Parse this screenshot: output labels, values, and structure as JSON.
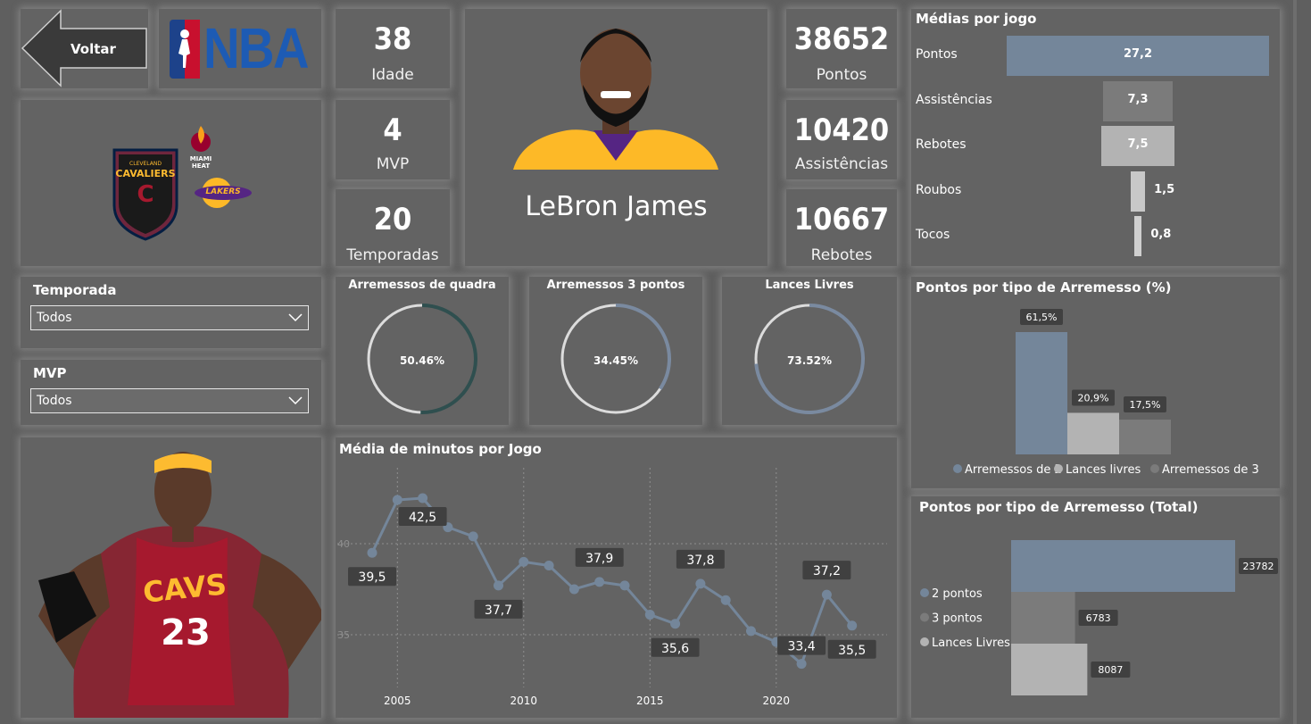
{
  "nav": {
    "back_label": "Voltar",
    "logo_text": "NBA"
  },
  "stats_left": [
    {
      "value": "38",
      "label": "Idade"
    },
    {
      "value": "4",
      "label": "MVP"
    },
    {
      "value": "20",
      "label": "Temporadas"
    }
  ],
  "stats_right": [
    {
      "value": "38652",
      "label": "Pontos"
    },
    {
      "value": "10420",
      "label": "Assistências"
    },
    {
      "value": "10667",
      "label": "Rebotes"
    }
  ],
  "player": {
    "name": "LeBron James",
    "jersey_number": "23",
    "jersey_text": "CAVS"
  },
  "teams": {
    "cavaliers_top": "CLEVELAND",
    "cavaliers_main": "CAVALIERS",
    "heat_top": "MIAMI",
    "heat_bottom": "HEAT",
    "lakers": "LAKERS"
  },
  "filters": [
    {
      "title": "Temporada",
      "value": "Todos"
    },
    {
      "title": "MVP",
      "value": "Todos"
    }
  ],
  "rings": [
    {
      "title": "Arremessos de quadra",
      "label": "50.46%",
      "value": 0.5046,
      "color": "#2f4f4f"
    },
    {
      "title": "Arremessos 3 pontos",
      "label": "34.45%",
      "value": 0.3445,
      "color": "#7a8aa0"
    },
    {
      "title": "Lances Livres",
      "label": "73.52%",
      "value": 0.7352,
      "color": "#7a8aa0"
    }
  ],
  "colors": {
    "steel": "#74869a",
    "gray_mid": "#7b7b7b",
    "gray_light": "#b3b3b3",
    "card": "#636363",
    "dark_label": "#404040"
  },
  "chart_data": [
    {
      "type": "bar",
      "title": "Médias por jogo",
      "orientation": "horizontal-funnel",
      "categories": [
        "Pontos",
        "Assistências",
        "Rebotes",
        "Roubos",
        "Tocos"
      ],
      "values": [
        27.2,
        7.3,
        7.5,
        1.5,
        0.8
      ],
      "labels": [
        "27,2",
        "7,3",
        "7,5",
        "1,5",
        "0,8"
      ],
      "colors": [
        "#74869a",
        "#7b7b7b",
        "#b3b3b3",
        "#c8c8c8",
        "#cfcfcf"
      ]
    },
    {
      "type": "bar",
      "title": "Pontos por tipo de Arremesso (%)",
      "categories": [
        "Arremessos de 2",
        "Lances livres",
        "Arremessos de 3"
      ],
      "values": [
        61.5,
        20.9,
        17.5
      ],
      "labels": [
        "61,5%",
        "20,9%",
        "17,5%"
      ],
      "colors": [
        "#74869a",
        "#b3b3b3",
        "#7b7b7b"
      ],
      "legend": "bottom"
    },
    {
      "type": "bar",
      "title": "Pontos por tipo de Arremesso (Total)",
      "orientation": "horizontal",
      "categories": [
        "2 pontos",
        "3 pontos",
        "Lances Livres"
      ],
      "values": [
        23782,
        6783,
        8087
      ],
      "labels": [
        "23782",
        "6783",
        "8087"
      ],
      "colors": [
        "#74869a",
        "#7b7b7b",
        "#b3b3b3"
      ],
      "legend": "left"
    },
    {
      "type": "line",
      "title": "Média de minutos por Jogo",
      "x": [
        2004,
        2005,
        2006,
        2007,
        2008,
        2009,
        2010,
        2011,
        2012,
        2013,
        2014,
        2015,
        2016,
        2017,
        2018,
        2019,
        2020,
        2021,
        2022,
        2023
      ],
      "y": [
        39.5,
        42.4,
        42.5,
        40.9,
        40.4,
        37.7,
        39.0,
        38.8,
        37.5,
        37.9,
        37.7,
        36.1,
        35.6,
        37.8,
        36.9,
        35.2,
        34.6,
        33.4,
        37.2,
        35.5
      ],
      "point_labels": [
        {
          "x": 2004,
          "text": "39,5"
        },
        {
          "x": 2006,
          "text": "42,5"
        },
        {
          "x": 2009,
          "text": "37,7"
        },
        {
          "x": 2013,
          "text": "37,9"
        },
        {
          "x": 2016,
          "text": "35,6"
        },
        {
          "x": 2017,
          "text": "37,8"
        },
        {
          "x": 2021,
          "text": "33,4"
        },
        {
          "x": 2022,
          "text": "37,2"
        },
        {
          "x": 2023,
          "text": "35,5"
        }
      ],
      "x_ticks": [
        "2005",
        "2010",
        "2015",
        "2020"
      ],
      "y_ticks": [
        "35",
        "40"
      ],
      "ylim": [
        32.5,
        43.5
      ],
      "grid": "dotted"
    }
  ]
}
